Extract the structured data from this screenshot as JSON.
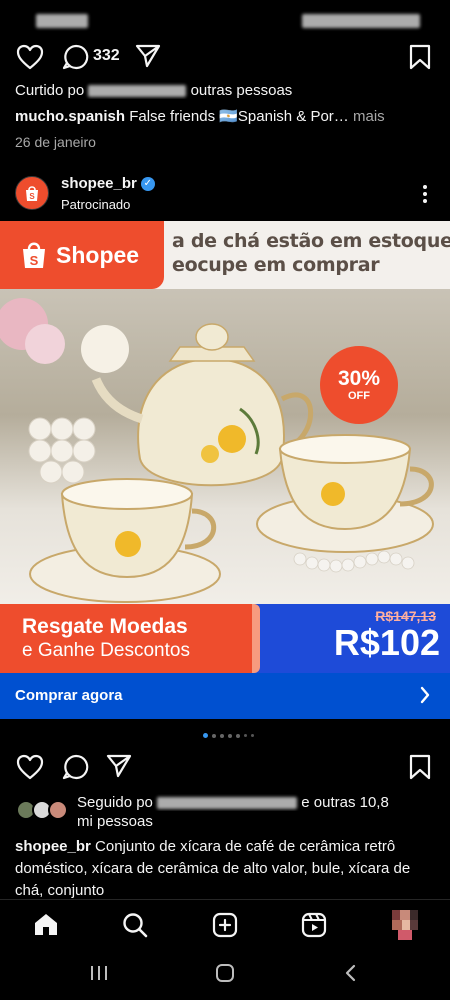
{
  "post_top": {
    "comment_count": "332",
    "liked_by_prefix": "Curtido po",
    "liked_by_suffix": "outras pessoas",
    "caption_user": "mucho.spanish",
    "caption_text": "False friends 🇦🇷Spanish & Por…",
    "more_label": "mais",
    "date": "26 de janeiro"
  },
  "ad_post": {
    "username": "shopee_br",
    "sponsored_label": "Patrocinado",
    "image": {
      "headline": "a de chá estão em estoque\neocupe em comprar",
      "brand_badge": "Shopee",
      "discount_pct": "30%",
      "discount_off": "OFF",
      "promo_line1": "Resgate Moedas",
      "promo_line2": "e Ganhe Descontos",
      "old_price": "R$147,13",
      "new_price": "R$102"
    },
    "cta_label": "Comprar agora",
    "carousel_page": 1,
    "carousel_total": 7,
    "followed_by_prefix": "Seguido po",
    "followed_by_suffix": "e outras 10,8",
    "followed_by_line2": "mi pessoas",
    "caption_user": "shopee_br",
    "caption_text": "Conjunto de xícara de café de cerâmica retrô doméstico, xícara de cerâmica de alto valor, bule, xícara de chá, conjunto"
  },
  "colors": {
    "shopee_orange": "#ee4d2d",
    "cta_blue": "#0050d0",
    "verified_blue": "#3797f0"
  },
  "bottom_nav": [
    "home-icon",
    "search-icon",
    "create-icon",
    "reels-icon",
    "profile-avatar"
  ],
  "system_nav": [
    "recents-icon",
    "home-circle-icon",
    "back-icon"
  ]
}
